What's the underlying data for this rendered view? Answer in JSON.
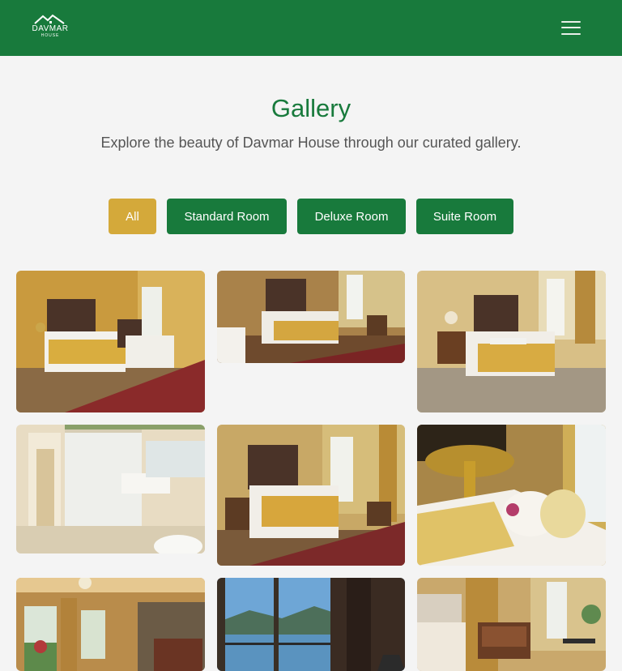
{
  "brand": {
    "name": "DAVMAR",
    "sub": "HOUSE"
  },
  "gallery": {
    "title": "Gallery",
    "subtitle": "Explore the beauty of Davmar House through our curated gallery."
  },
  "filters": [
    {
      "label": "All",
      "active": true
    },
    {
      "label": "Standard Room",
      "active": false
    },
    {
      "label": "Deluxe Room",
      "active": false
    },
    {
      "label": "Suite Room",
      "active": false
    }
  ],
  "colors": {
    "brand_green": "#187a3c",
    "active_gold": "#d4a93a",
    "page_bg": "#f4f4f4"
  },
  "icons": {
    "menu": "hamburger-menu-icon",
    "logo": "house-roof-logo-icon"
  }
}
